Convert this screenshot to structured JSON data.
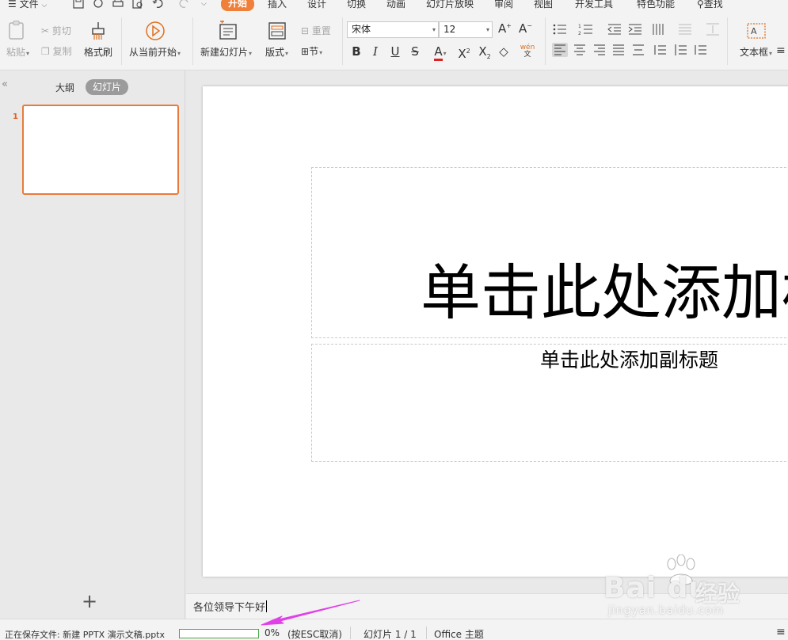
{
  "menubar": {
    "file": "文件",
    "tabs": [
      "开始",
      "插入",
      "设计",
      "切换",
      "动画",
      "幻灯片放映",
      "审阅",
      "视图",
      "开发工具",
      "特色功能"
    ],
    "active_tab": "开始",
    "search": "查找",
    "accent_color": "#f07f3a"
  },
  "ribbon": {
    "paste": "粘贴",
    "cut": "剪切",
    "copy": "复制",
    "format_painter": "格式刷",
    "from_current": "从当前开始",
    "new_slide": "新建幻灯片",
    "layout": "版式",
    "reset": "重置",
    "section": "节",
    "font_name": "宋体",
    "font_size": "12",
    "textbox": "文本框",
    "phonetic": "wén"
  },
  "left_panel": {
    "tab_outline": "大纲",
    "tab_slides": "幻灯片",
    "slide_number": "1"
  },
  "slide": {
    "title_placeholder": "单击此处添加标题",
    "subtitle_placeholder": "单击此处添加副标题"
  },
  "notes": {
    "text": "各位领导下午好"
  },
  "statusbar": {
    "saving": "正在保存文件: 新建 PPTX 演示文稿.pptx",
    "progress_percent": 0,
    "progress_label": "0%",
    "cancel_hint": "(按ESC取消)",
    "slide_counter": "幻灯片 1 / 1",
    "theme": "Office 主题"
  },
  "watermark": {
    "brand": "Bai du",
    "brand_cn": "经验",
    "url": "jingyan.baidu.com"
  },
  "colors": {
    "selection": "#e87b3c",
    "progress": "#4aa84a",
    "annotation_arrow": "#e040e8"
  }
}
